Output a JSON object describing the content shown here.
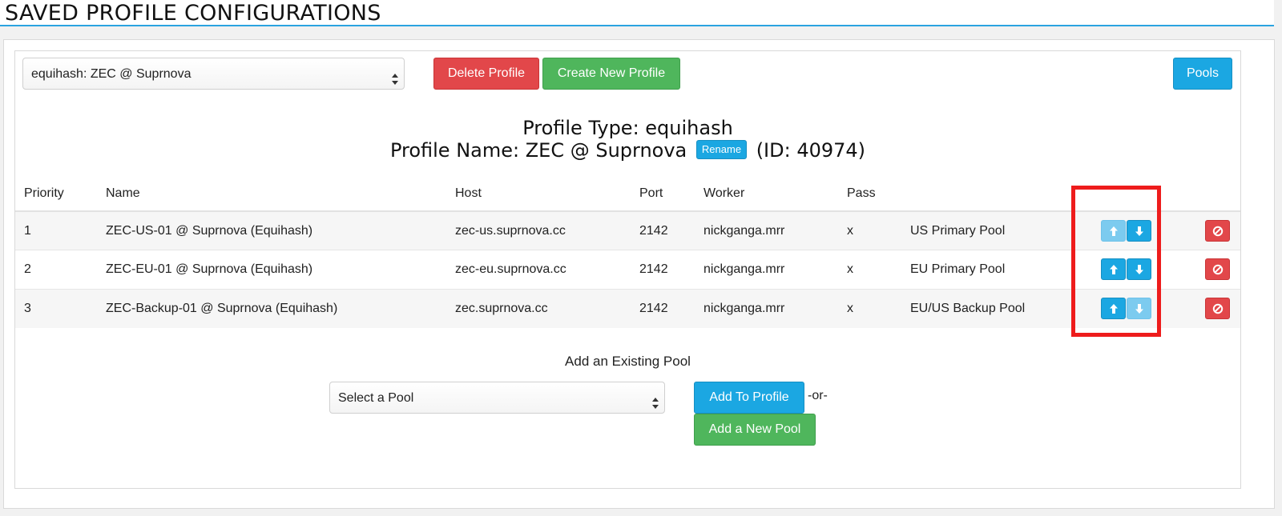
{
  "page_title": "SAVED PROFILE CONFIGURATIONS",
  "toolbar": {
    "profile_select": "equihash: ZEC @ Suprnova",
    "delete_label": "Delete Profile",
    "create_label": "Create New Profile",
    "pools_label": "Pools"
  },
  "profile": {
    "type_line": "Profile Type: equihash",
    "name_prefix": "Profile Name: ZEC @ Suprnova",
    "rename_label": "Rename",
    "id_text": "(ID: 40974)"
  },
  "table": {
    "headers": [
      "Priority",
      "Name",
      "Host",
      "Port",
      "Worker",
      "Pass"
    ],
    "rows": [
      {
        "priority": "1",
        "name": "ZEC-US-01 @ Suprnova (Equihash)",
        "host": "zec-us.suprnova.cc",
        "port": "2142",
        "worker": "nickganga.mrr",
        "pass": "x",
        "notes": "US Primary Pool",
        "up_enabled": false,
        "down_enabled": true
      },
      {
        "priority": "2",
        "name": "ZEC-EU-01 @ Suprnova (Equihash)",
        "host": "zec-eu.suprnova.cc",
        "port": "2142",
        "worker": "nickganga.mrr",
        "pass": "x",
        "notes": "EU Primary Pool",
        "up_enabled": true,
        "down_enabled": true
      },
      {
        "priority": "3",
        "name": "ZEC-Backup-01 @ Suprnova (Equihash)",
        "host": "zec.suprnova.cc",
        "port": "2142",
        "worker": "nickganga.mrr",
        "pass": "x",
        "notes": "EU/US Backup Pool",
        "up_enabled": true,
        "down_enabled": false
      }
    ]
  },
  "add_pool": {
    "label": "Add an Existing Pool",
    "select_placeholder": "Select a Pool",
    "add_to_profile_label": "Add To Profile",
    "or_text": "-or-",
    "add_new_label": "Add a New Pool"
  },
  "icons": {
    "up": "arrow-up-icon",
    "down": "arrow-down-icon",
    "delete": "ban-icon",
    "select": "select-updown-icon"
  },
  "colors": {
    "accent_blue": "#1ba7e2",
    "danger_red": "#e2474a",
    "success_green": "#4fb65c",
    "highlight_red": "#ee1c1c"
  }
}
